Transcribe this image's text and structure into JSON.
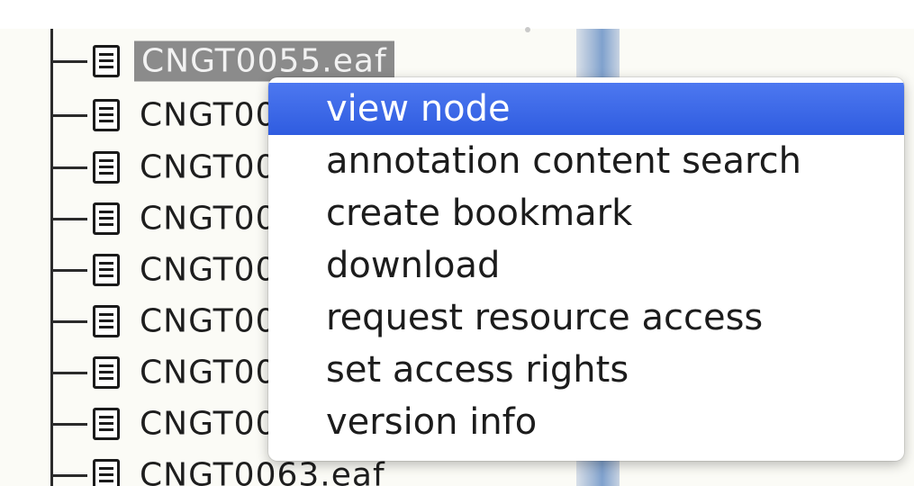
{
  "tree": {
    "items": [
      {
        "label": "CNGT0055.eaf",
        "selected": true
      },
      {
        "label": "CNGT00",
        "selected": false
      },
      {
        "label": "CNGT00",
        "selected": false
      },
      {
        "label": "CNGT00",
        "selected": false
      },
      {
        "label": "CNGT00",
        "selected": false
      },
      {
        "label": "CNGT00",
        "selected": false
      },
      {
        "label": "CNGT00",
        "selected": false
      },
      {
        "label": "CNGT00",
        "selected": false
      },
      {
        "label": "CNGT0063.eaf",
        "selected": false
      }
    ],
    "icon": "document-icon"
  },
  "context_menu": {
    "items": [
      {
        "label": "view node",
        "highlighted": true
      },
      {
        "label": "annotation content search",
        "highlighted": false
      },
      {
        "label": "create bookmark",
        "highlighted": false
      },
      {
        "label": "download",
        "highlighted": false
      },
      {
        "label": "request resource access",
        "highlighted": false
      },
      {
        "label": "set access rights",
        "highlighted": false
      },
      {
        "label": "version info",
        "highlighted": false
      }
    ]
  },
  "colors": {
    "highlight": "#3a64e8",
    "selection": "#8b8b8b",
    "tree_background": "#fbfbf6",
    "scrollbar": "#7fa1cd"
  }
}
